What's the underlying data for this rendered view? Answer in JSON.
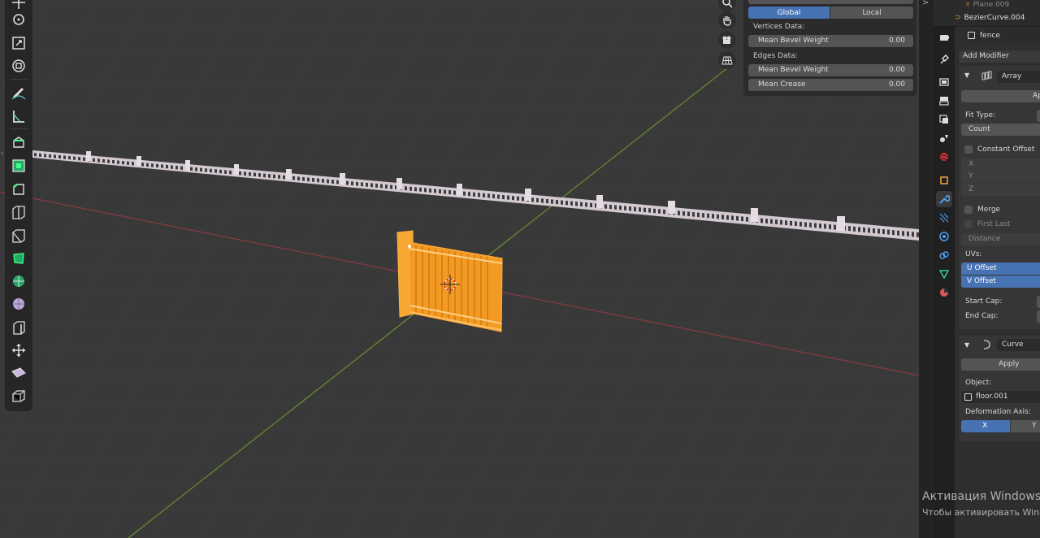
{
  "npanel": {
    "seg_global": "Global",
    "seg_local": "Local",
    "vertices_label": "Vertices Data:",
    "vertices_bevel_label": "Mean Bevel Weight",
    "vertices_bevel_value": "0.00",
    "edges_label": "Edges Data:",
    "edges_bevel_label": "Mean Bevel Weight",
    "edges_bevel_value": "0.00",
    "crease_label": "Mean Crease",
    "crease_value": "0.00"
  },
  "outliner": {
    "items": [
      {
        "label": "Plane.009"
      },
      {
        "label": "BezierCurve.004"
      }
    ]
  },
  "properties": {
    "object_name": "fence",
    "add_modifier": "Add Modifier",
    "array": {
      "name": "Array",
      "apply": "Appl",
      "fit_type_label": "Fit Type:",
      "fit_type_value": "Count",
      "constant_offset": "Constant Offset",
      "x": "X",
      "y": "Y",
      "z": "Z",
      "merge": "Merge",
      "first_last": "First Last",
      "distance": "Distance",
      "uvs_label": "UVs:",
      "u_offset": "U Offset",
      "v_offset": "V Offset",
      "start_cap": "Start Cap:",
      "end_cap": "End Cap:"
    },
    "curve": {
      "name": "Curve",
      "apply": "Apply",
      "object_label": "Object:",
      "object_value": "floor.001",
      "deformation_axis_label": "Deformation Axis:",
      "axis_x": "X",
      "axis_y": "Y"
    }
  },
  "watermark": {
    "line1": "Активация Windows",
    "line2": "Чтобы активировать Windo"
  },
  "colors": {
    "accent_blue": "#4772b3",
    "selection_orange": "#ff9d1e",
    "x_axis_red": "#9a3b44",
    "y_axis_green": "#6a8f2f"
  }
}
